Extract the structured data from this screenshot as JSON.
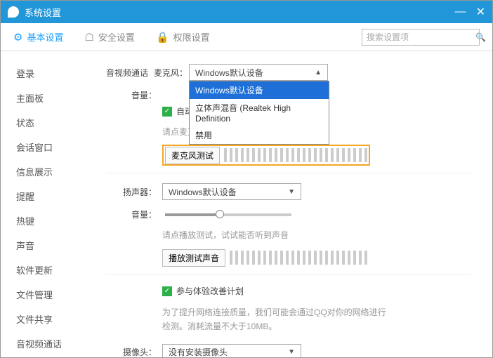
{
  "window": {
    "title": "系统设置"
  },
  "tabs": {
    "basic": "基本设置",
    "security": "安全设置",
    "permission": "权限设置"
  },
  "search": {
    "placeholder": "搜索设置项"
  },
  "sidebar": {
    "items": [
      "登录",
      "主面板",
      "状态",
      "会话窗口",
      "信息展示",
      "提醒",
      "热键",
      "声音",
      "软件更新",
      "文件管理",
      "文件共享",
      "音视频通话"
    ]
  },
  "content": {
    "section": "音视频通话",
    "mic": {
      "label": "麦克风：",
      "selected": "Windows默认设备",
      "options": [
        "Windows默认设备",
        "立体声混音 (Realtek High Definition",
        "禁用"
      ]
    },
    "volume_label": "音量：",
    "auto_prefix": "自动",
    "mic_hint": "请点麦克风测试，对着麦克风说话进行试听",
    "mic_test_btn": "麦克风测试",
    "speaker": {
      "label": "扬声器：",
      "selected": "Windows默认设备"
    },
    "speaker_hint": "请点播放测试，试试能否听到声音",
    "speaker_test_btn": "播放测试声音",
    "improve_label": "参与体验改善计划",
    "improve_hint": "为了提升网络连接质量，我们可能会通过QQ对你的网络进行检测。消耗流量不大于10MB。",
    "camera": {
      "label": "摄像头：",
      "selected": "没有安装摄像头"
    }
  }
}
